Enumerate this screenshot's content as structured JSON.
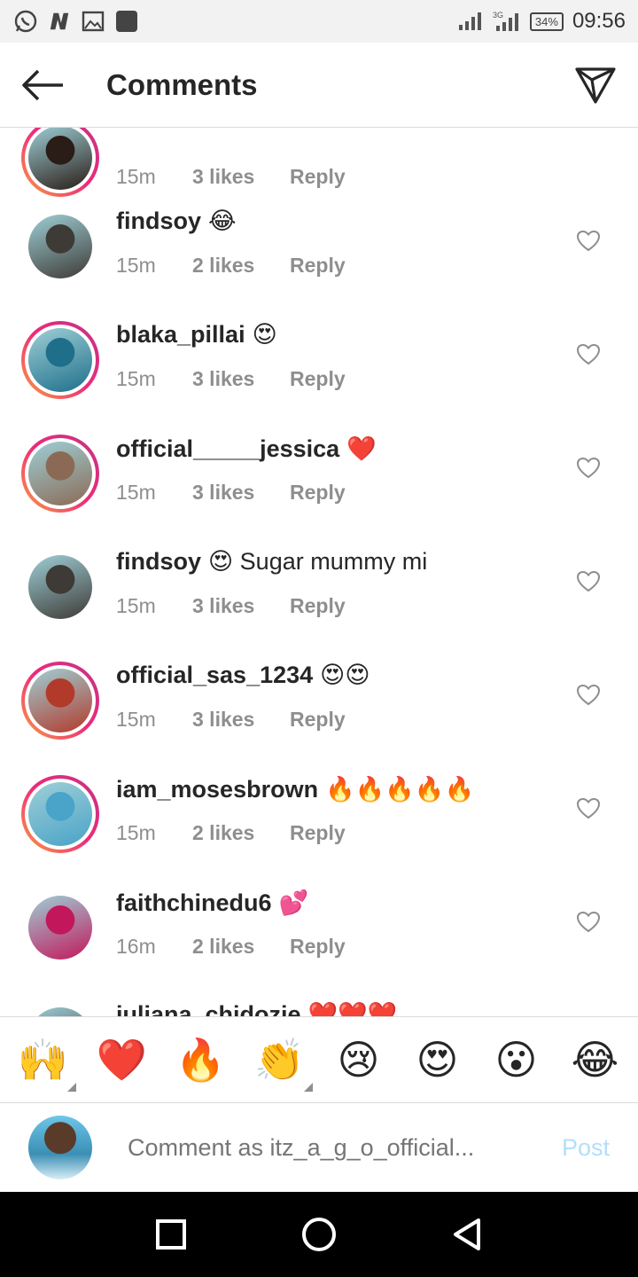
{
  "status_bar": {
    "time": "09:56",
    "battery": "34%",
    "network": "3G",
    "left_icons": [
      "whatsapp-icon",
      "n-app-icon",
      "image-icon",
      "square-app-icon"
    ]
  },
  "header": {
    "title": "Comments"
  },
  "comments": [
    {
      "user": "",
      "text": "",
      "time": "15m",
      "likes": "3 likes",
      "reply": "Reply",
      "ring": true,
      "avatar_color": "#2a1c16"
    },
    {
      "user": "findsoy",
      "text": "😂",
      "time": "15m",
      "likes": "2 likes",
      "reply": "Reply",
      "ring": false,
      "avatar_color": "#3e3a36"
    },
    {
      "user": "blaka_pillai",
      "text": "😍",
      "time": "15m",
      "likes": "3 likes",
      "reply": "Reply",
      "ring": true,
      "avatar_color": "#1f6f8b"
    },
    {
      "user": "official_____jessica",
      "text": "❤️",
      "time": "15m",
      "likes": "3 likes",
      "reply": "Reply",
      "ring": true,
      "avatar_color": "#8b6a55"
    },
    {
      "user": "findsoy",
      "text": "😍 Sugar mummy mi",
      "time": "15m",
      "likes": "3 likes",
      "reply": "Reply",
      "ring": false,
      "avatar_color": "#3e3a36"
    },
    {
      "user": "official_sas_1234",
      "text": "😍😍",
      "time": "15m",
      "likes": "3 likes",
      "reply": "Reply",
      "ring": true,
      "avatar_color": "#b23a2a"
    },
    {
      "user": "iam_mosesbrown",
      "text": "🔥🔥🔥🔥🔥",
      "time": "15m",
      "likes": "2 likes",
      "reply": "Reply",
      "ring": true,
      "avatar_color": "#4aa3c8"
    },
    {
      "user": "faithchinedu6",
      "text": "💕",
      "time": "16m",
      "likes": "2 likes",
      "reply": "Reply",
      "ring": false,
      "avatar_color": "#c2185b"
    },
    {
      "user": "iuliana_chidozie",
      "text": "❤️❤️❤️",
      "time": "",
      "likes": "",
      "reply": "",
      "ring": false,
      "avatar_color": "#2b2b2b"
    }
  ],
  "emoji_bar": [
    "🙌",
    "❤️",
    "🔥",
    "👏",
    "😢",
    "😍",
    "😮",
    "😂"
  ],
  "comment_input": {
    "placeholder": "Comment as itz_a_g_o_official...",
    "post_label": "Post"
  }
}
